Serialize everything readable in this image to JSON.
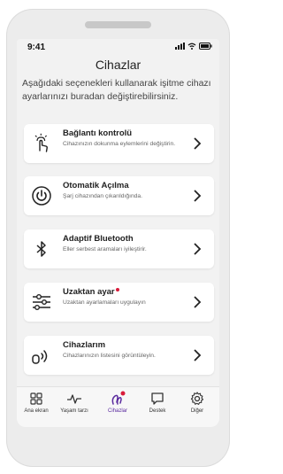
{
  "status": {
    "time": "9:41"
  },
  "header": {
    "title": "Cihazlar",
    "description": "Aşağıdaki seçenekleri kullanarak işitme cihazı ayarlarınızı buradan değiştirebilirsiniz."
  },
  "cards": [
    {
      "title": "Bağlantı kontrolü",
      "subtitle": "Cihazınızın dokunma eylemlerini değiştirin.",
      "icon": "tap-gesture-icon"
    },
    {
      "title": "Otomatik Açılma",
      "subtitle": "Şarj cihazından çıkarıldığında.",
      "icon": "power-icon"
    },
    {
      "title": "Adaptif Bluetooth",
      "subtitle": "Eller serbest aramaları iyileştirir.",
      "icon": "bluetooth-icon"
    },
    {
      "title": "Uzaktan ayar",
      "subtitle": "Uzaktan ayarlamaları uygulayın",
      "icon": "sliders-icon",
      "badge": true
    },
    {
      "title": "Cihazlarım",
      "subtitle": "Cihazlarınızın listesini görüntüleyin.",
      "icon": "hearing-aid-icon"
    }
  ],
  "tabs": [
    {
      "label": "Ana ekran",
      "icon": "grid-icon"
    },
    {
      "label": "Yaşam tarzı",
      "icon": "activity-icon"
    },
    {
      "label": "Cihazlar",
      "icon": "hearing-aids-icon",
      "active": true
    },
    {
      "label": "Destek",
      "icon": "chat-icon"
    },
    {
      "label": "Diğer",
      "icon": "gear-icon"
    }
  ],
  "colors": {
    "accent": "#5a2a9e",
    "badge": "#d81b3a",
    "background": "#f2f2f2"
  }
}
